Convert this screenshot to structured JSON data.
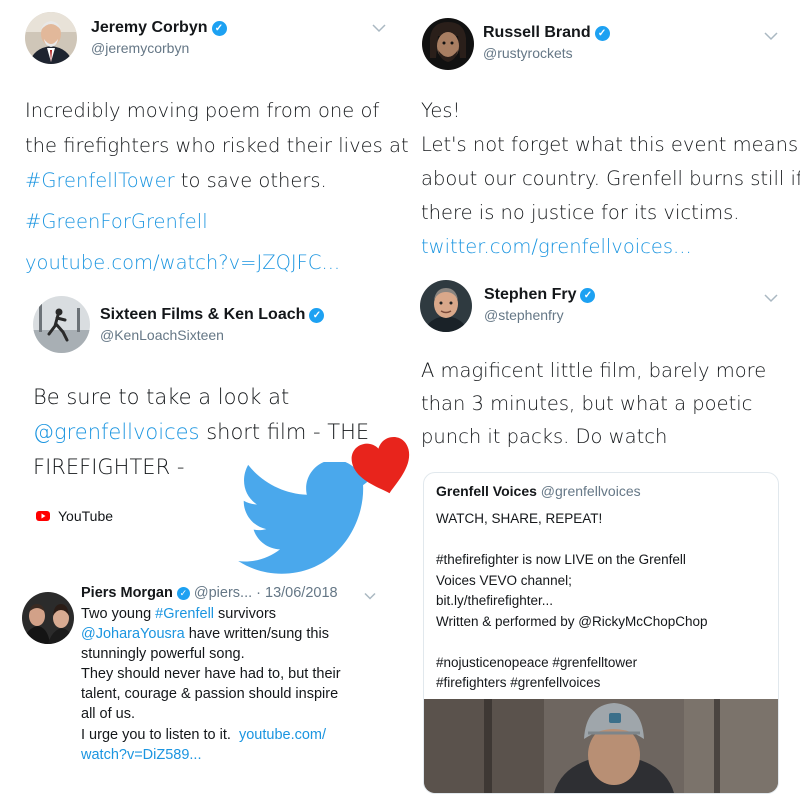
{
  "corbyn": {
    "name": "Jeremy Corbyn",
    "handle": "@jeremycorbyn",
    "line1": "Incredibly moving poem from one of",
    "line2": "the firefighters who risked their lives at",
    "line3_link": "#GrenfellTower",
    "line3_rest": " to save others.",
    "hashtag": "#GreenForGrenfell",
    "url": "youtube.com/watch?v=JZQJFC..."
  },
  "brand": {
    "name": "Russell Brand",
    "handle": "@rustyrockets",
    "line1": "Yes!",
    "line2": "Let's not forget what this event means",
    "line3": "about our country. Grenfell burns still if",
    "line4": "there is no justice for its victims.",
    "url": "twitter.com/grenfellvoices..."
  },
  "loach": {
    "name": "Sixteen Films & Ken Loach",
    "handle": "@KenLoachSixteen",
    "line1": "Be sure to take a look at",
    "line2_link": "@grenfellvoices",
    "line2_rest": " short film - THE",
    "line3": "FIREFIGHTER -",
    "source": "YouTube"
  },
  "fry": {
    "name": "Stephen Fry",
    "handle": "@stephenfry",
    "line1": "A magificent little film, barely more",
    "line2": "than 3 minutes, but what a poetic",
    "line3": "punch it packs. Do watch"
  },
  "quote": {
    "name": "Grenfell Voices",
    "handle": "@grenfellvoices",
    "lines": [
      "WATCH, SHARE, REPEAT!",
      "",
      "#thefirefighter is now LIVE on the Grenfell",
      "Voices VEVO channel;",
      "bit.ly/thefirefighter...",
      "Written & performed by @RickyMcChopChop",
      "",
      "#nojusticenopeace #grenfelltower",
      "#firefighters #grenfellvoices"
    ]
  },
  "morgan": {
    "name": "Piers Morgan",
    "handle": "@piers...",
    "date": "· 13/06/2018",
    "line1_a": "Two young ",
    "line1_link": "#Grenfell",
    "line1_b": " survivors",
    "line2_link": "@JoharaYousra",
    "line2_rest": " have written/sung this",
    "line3": "stunningly powerful song.",
    "line4": "They should never have had to, but their",
    "line5": "talent, courage & passion should inspire",
    "line6": "all of us.",
    "line7_a": "I urge you to listen to it.  ",
    "line7_link": "youtube.com/",
    "line8_link": "watch?v=DiZ589..."
  },
  "icons": {
    "verified": "verified-badge",
    "chevron": "chevron-down",
    "bird": "twitter-bird",
    "heart": "red-heart",
    "youtube": "youtube-logo"
  },
  "colors": {
    "link": "#1b95e0",
    "verified": "#1da1f2",
    "bird": "#4aa8ec",
    "heart": "#e8241c",
    "youtube": "#ff0000"
  }
}
